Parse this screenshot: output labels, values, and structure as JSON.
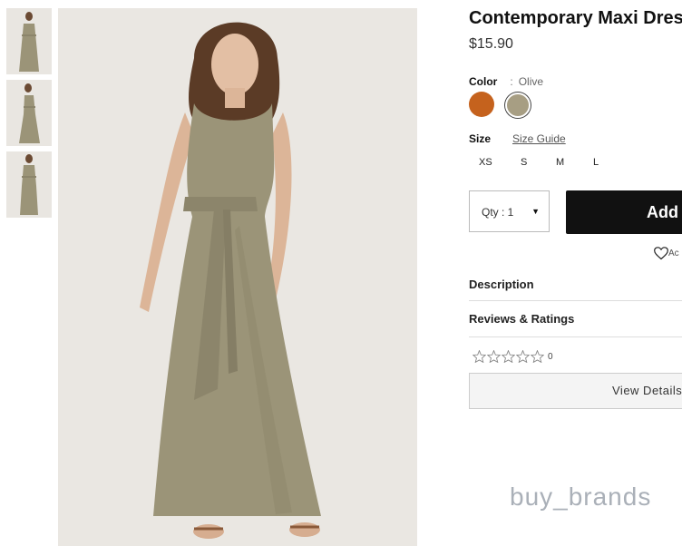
{
  "product": {
    "title": "Contemporary Maxi Dress",
    "price": "$15.90"
  },
  "color": {
    "label": "Color",
    "separator": ":",
    "selected": "Olive",
    "swatches": [
      {
        "name": "rust",
        "hex": "#c5621d"
      },
      {
        "name": "olive",
        "hex": "#a79e83"
      }
    ]
  },
  "size": {
    "label": "Size",
    "guide_label": "Size Guide",
    "options": [
      "XS",
      "S",
      "M",
      "L"
    ]
  },
  "qty": {
    "label": "Qty : 1"
  },
  "actions": {
    "add_label": "Add",
    "wishlist_label": "Ac"
  },
  "accordion": {
    "description": "Description",
    "reviews": "Reviews & Ratings"
  },
  "rating": {
    "count": "0",
    "stars_filled": 0,
    "stars_total": 5
  },
  "view_details_label": "View Details",
  "watermark": "buy_brands",
  "colors": {
    "dress": "#9b9478",
    "button_bg": "#111111"
  }
}
